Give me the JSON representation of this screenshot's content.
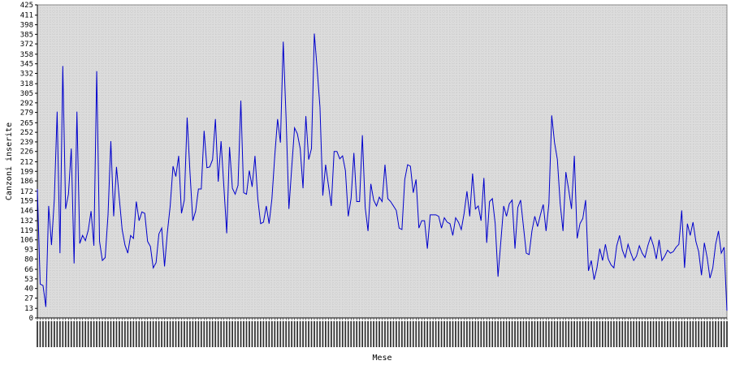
{
  "chart_data": {
    "type": "line",
    "title": "",
    "xlabel": "Mese",
    "ylabel": "Canzoni inserite",
    "ylim": [
      0,
      425
    ],
    "yticks": [
      0,
      13,
      27,
      40,
      53,
      66,
      80,
      93,
      106,
      119,
      132,
      146,
      159,
      172,
      186,
      199,
      212,
      226,
      239,
      252,
      265,
      279,
      292,
      305,
      318,
      332,
      345,
      358,
      372,
      385,
      398,
      411,
      425
    ],
    "grid": true,
    "legend": "none",
    "colors": {
      "line": "#0000cc",
      "plot_bg": "#dcdcdc",
      "grid": "#bcbcbc"
    },
    "x_tick_note": "x labels are too small and dense to read individually",
    "series": [
      {
        "values": [
          175,
          46,
          44,
          15,
          152,
          99,
          161,
          280,
          88,
          342,
          148,
          168,
          230,
          74,
          280,
          101,
          112,
          105,
          119,
          145,
          98,
          335,
          104,
          78,
          82,
          140,
          240,
          138,
          205,
          162,
          120,
          99,
          88,
          112,
          108,
          158,
          132,
          144,
          142,
          104,
          97,
          68,
          75,
          114,
          122,
          70,
          116,
          152,
          206,
          192,
          220,
          142,
          160,
          272,
          198,
          132,
          145,
          175,
          175,
          254,
          204,
          205,
          215,
          270,
          185,
          240,
          178,
          115,
          232,
          176,
          168,
          180,
          295,
          170,
          168,
          200,
          178,
          220,
          162,
          128,
          130,
          152,
          128,
          162,
          220,
          270,
          238,
          375,
          272,
          148,
          204,
          258,
          250,
          230,
          176,
          274,
          215,
          230,
          386,
          338,
          286,
          166,
          208,
          180,
          152,
          226,
          226,
          216,
          220,
          200,
          138,
          162,
          224,
          158,
          158,
          248,
          150,
          118,
          182,
          160,
          152,
          164,
          158,
          208,
          162,
          158,
          152,
          146,
          122,
          120,
          188,
          208,
          206,
          170,
          188,
          122,
          132,
          132,
          94,
          140,
          140,
          140,
          138,
          122,
          136,
          130,
          128,
          112,
          136,
          130,
          120,
          142,
          172,
          138,
          196,
          148,
          152,
          132,
          190,
          102,
          158,
          162,
          128,
          56,
          104,
          152,
          138,
          155,
          160,
          94,
          150,
          160,
          124,
          88,
          86,
          118,
          138,
          124,
          140,
          154,
          118,
          155,
          275,
          238,
          215,
          155,
          118,
          198,
          174,
          148,
          220,
          108,
          128,
          135,
          160,
          64,
          78,
          52,
          68,
          94,
          78,
          100,
          80,
          72,
          68,
          98,
          112,
          92,
          82,
          100,
          88,
          78,
          84,
          98,
          88,
          82,
          98,
          110,
          98,
          80,
          106,
          78,
          84,
          92,
          88,
          90,
          96,
          100,
          146,
          68,
          128,
          112,
          130,
          104,
          90,
          58,
          102,
          82,
          54,
          68,
          100,
          118,
          88,
          96,
          10
        ]
      }
    ]
  }
}
